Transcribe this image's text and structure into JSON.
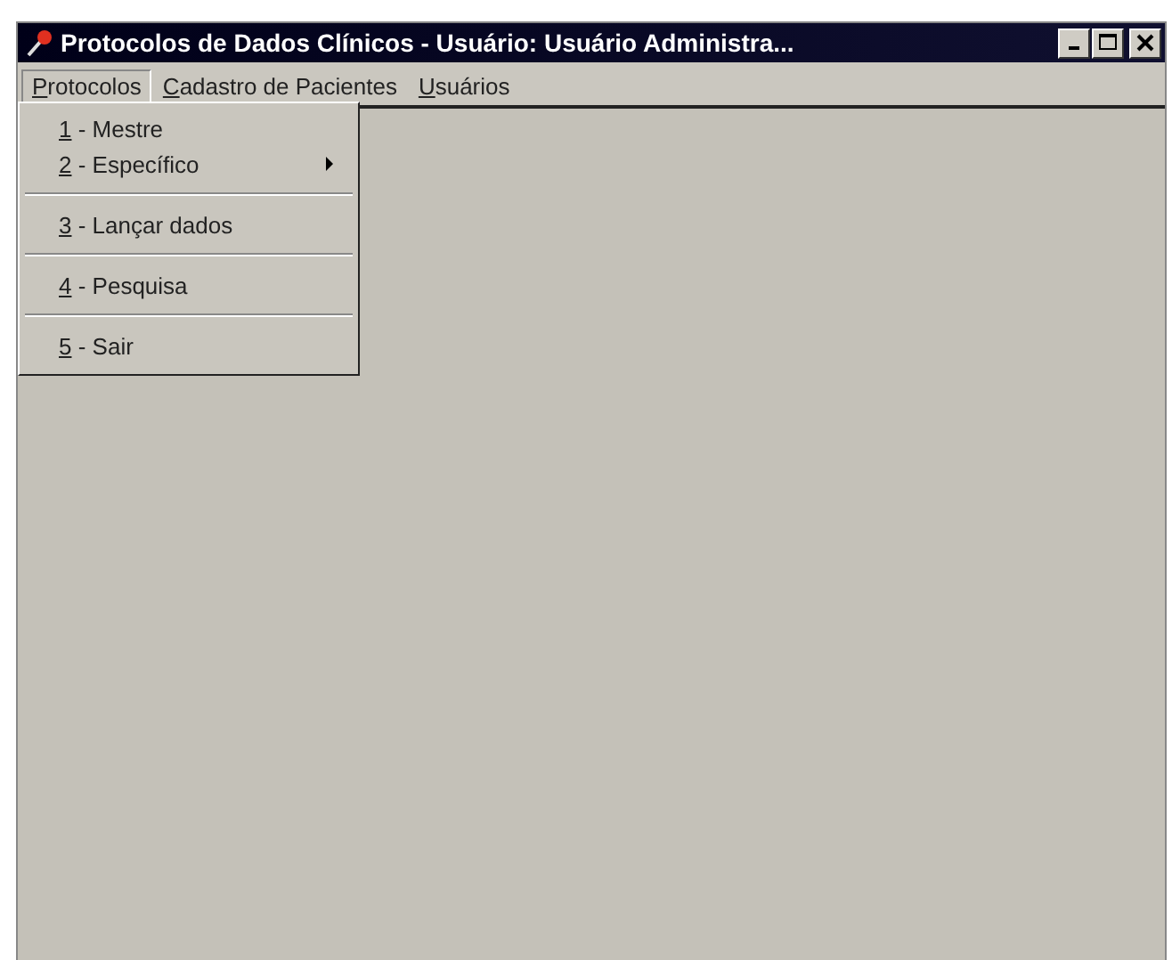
{
  "window": {
    "title": "Protocolos de Dados Clínicos - Usuário: Usuário Administra..."
  },
  "menu_bar": [
    {
      "label": "Protocolos",
      "selected": true,
      "mnemonic_underlined": true
    },
    {
      "label": "Cadastro de Pacientes",
      "selected": false,
      "mnemonic_underlined": true
    },
    {
      "label": "Usuários",
      "selected": false,
      "mnemonic_underlined": true
    }
  ],
  "dropdown": [
    {
      "kind": "item",
      "label": "1 - Mestre",
      "submenu": false,
      "mnemonic_underlined": true
    },
    {
      "kind": "item",
      "label": "2 - Específico",
      "submenu": true,
      "mnemonic_underlined": true
    },
    {
      "kind": "separator"
    },
    {
      "kind": "item",
      "label": "3 - Lançar dados",
      "submenu": false,
      "mnemonic_underlined": true
    },
    {
      "kind": "separator"
    },
    {
      "kind": "item",
      "label": "4 - Pesquisa",
      "submenu": false,
      "mnemonic_underlined": true
    },
    {
      "kind": "separator"
    },
    {
      "kind": "item",
      "label": "5 - Sair",
      "submenu": false,
      "mnemonic_underlined": true
    }
  ]
}
